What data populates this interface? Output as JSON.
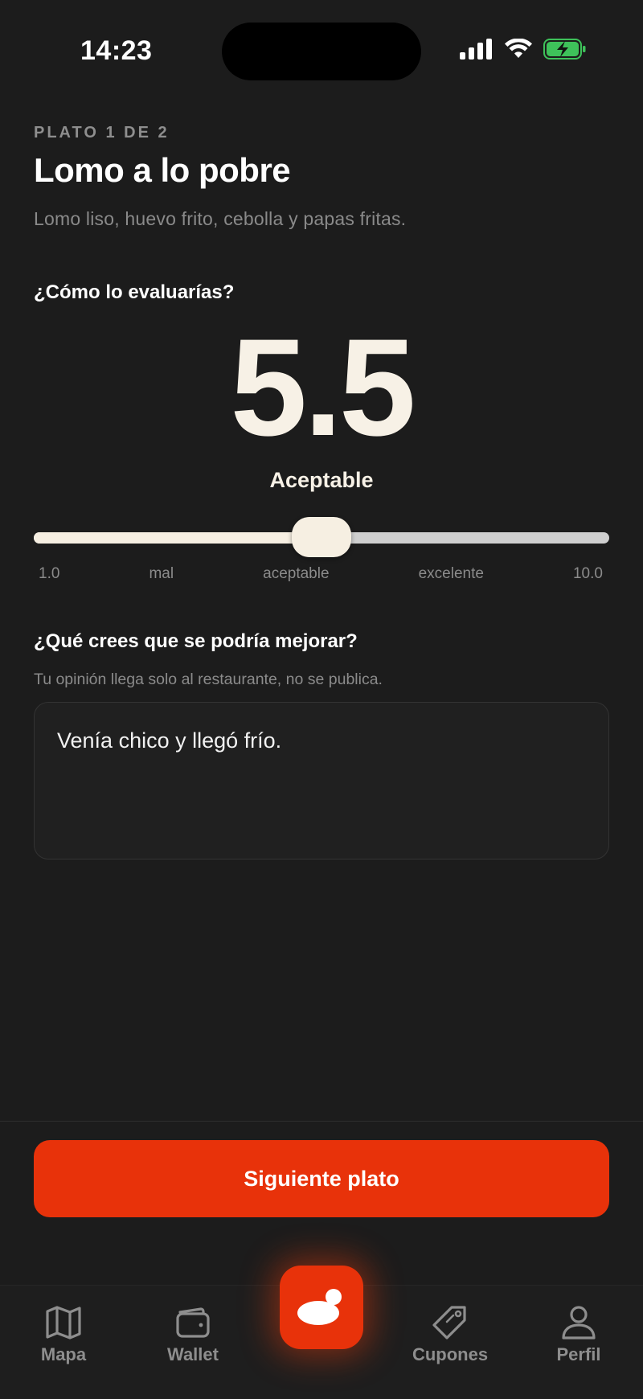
{
  "status_bar": {
    "time": "14:23"
  },
  "header": {
    "eyebrow": "PLATO 1 DE 2",
    "title": "Lomo a lo pobre",
    "description": "Lomo liso, huevo frito, cebolla y papas fritas."
  },
  "rating": {
    "question": "¿Cómo lo evaluarías?",
    "score": "5.5",
    "score_label": "Aceptable",
    "slider_value": 5.5,
    "slider_min": 1.0,
    "slider_max": 10.0,
    "scale_labels": [
      "1.0",
      "mal",
      "aceptable",
      "excelente",
      "10.0"
    ]
  },
  "feedback": {
    "question": "¿Qué crees que se podría mejorar?",
    "hint": "Tu opinión llega solo al restaurante, no se publica.",
    "value": "Venía chico y llegó frío."
  },
  "cta": {
    "label": "Siguiente plato"
  },
  "tabbar": {
    "tabs": [
      {
        "label": "Mapa",
        "icon": "map-icon"
      },
      {
        "label": "Wallet",
        "icon": "wallet-icon"
      },
      {
        "label": "",
        "icon": "app-logo-icon"
      },
      {
        "label": "Cupones",
        "icon": "tag-icon"
      },
      {
        "label": "Perfil",
        "icon": "person-icon"
      }
    ]
  },
  "colors": {
    "accent": "#e8320a",
    "background": "#1c1c1c",
    "cream": "#f6efe2"
  }
}
